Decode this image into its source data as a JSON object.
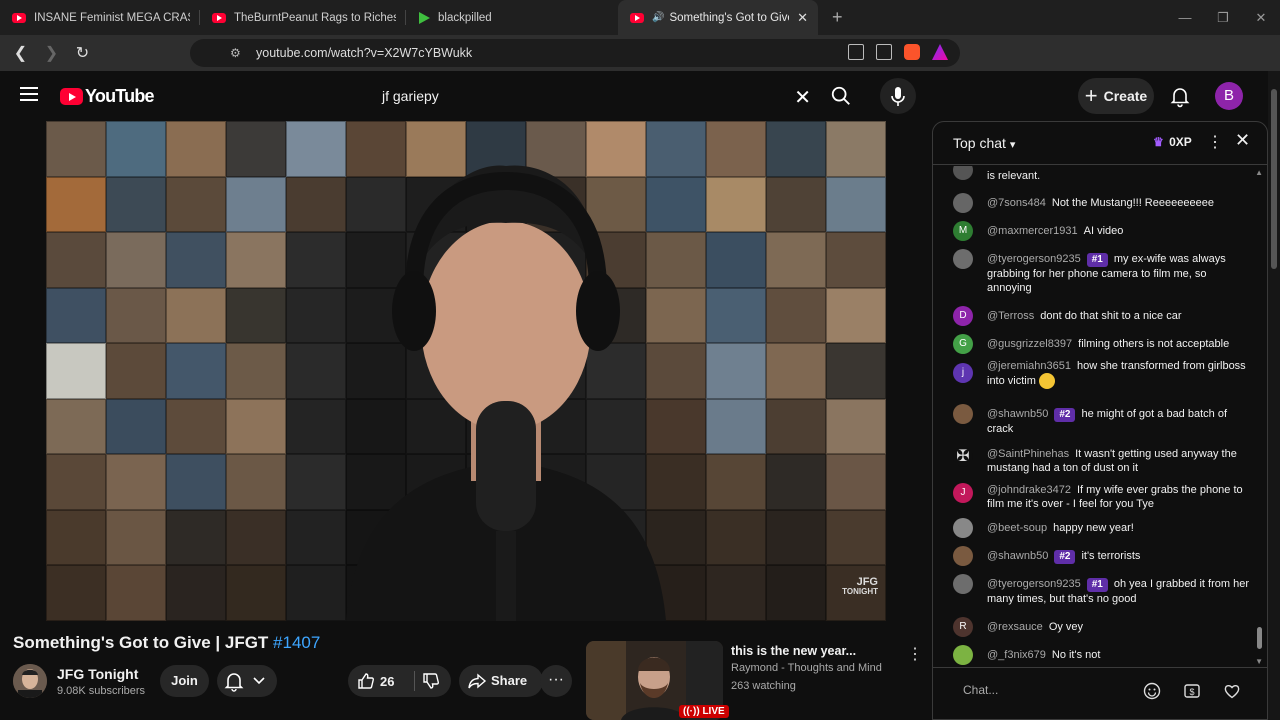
{
  "browser": {
    "tabs": [
      {
        "label": "INSANE Feminist MEGA CRASHOUT",
        "icon": "youtube-icon"
      },
      {
        "label": "TheBurntPeanut Rags to Riches | ARC",
        "icon": "youtube-icon"
      },
      {
        "label": "blackpilled",
        "icon": "play-green-icon"
      },
      {
        "label": "Something's Got to Give | JFGT",
        "icon": "youtube-icon",
        "active": true
      }
    ],
    "url": "youtube.com/watch?v=X2W7cYBWukk"
  },
  "masthead": {
    "logo_text": "YouTube",
    "search_query": "jf gariepy",
    "create_label": "Create",
    "avatar_letter": "B"
  },
  "video": {
    "title_main": "Something's Got to Give | JFGT ",
    "title_hashtag": "#1407",
    "watermark_line1": "JFG",
    "watermark_line2": "TONIGHT",
    "channel": "JFG Tonight",
    "subscribers": "9.08K subscribers",
    "join_label": "Join",
    "likes": "26",
    "share_label": "Share",
    "more_label": "···"
  },
  "suggested": {
    "title": "this is the new year...",
    "channel": "Raymond - Thoughts and Mind",
    "watching": "263 watching",
    "live_label": "LIVE"
  },
  "chat": {
    "header": "Top chat",
    "xp": "0XP",
    "input_placeholder": "Chat...",
    "messages": [
      {
        "author": "",
        "text": "is relevant.",
        "badge": "",
        "avatar": "",
        "color": "#555"
      },
      {
        "author": "@7sons484",
        "text": "Not the Mustang!!! Reeeeeeeeee",
        "badge": "",
        "avatar": "",
        "color": "#666"
      },
      {
        "author": "@maxmercer1931",
        "text": "AI video",
        "badge": "",
        "avatar": "M",
        "color": "#2e7d32"
      },
      {
        "author": "@tyerogerson9235",
        "text": "my ex-wife was always grabbing for her phone camera to film me, so annoying",
        "badge": "#1",
        "avatar": "",
        "color": "#6d6d6d"
      },
      {
        "author": "@Terross",
        "text": "dont do that shit to a nice car",
        "badge": "",
        "avatar": "D",
        "color": "#8e24aa"
      },
      {
        "author": "@gusgrizzel8397",
        "text": "filming others is not acceptable",
        "badge": "",
        "avatar": "G",
        "color": "#43a047"
      },
      {
        "author": "@jeremiahn3651",
        "text": "how she transformed from girlboss into victim",
        "badge": "",
        "avatar": "j",
        "color": "#5e35b1"
      },
      {
        "author": "@shawnb50",
        "text": "he might of got a bad batch of crack",
        "badge": "#2",
        "avatar": "",
        "color": "#7a5a40"
      },
      {
        "author": "@SaintPhinehas",
        "text": "It wasn't getting used anyway the mustang had a ton of dust on it",
        "badge": "",
        "avatar": "✠",
        "color": "#0f0f0f"
      },
      {
        "author": "@johndrake3472",
        "text": "If my wife ever grabs the phone to film me it's over - I feel for you Tye",
        "badge": "",
        "avatar": "J",
        "color": "#c2185b"
      },
      {
        "author": "@beet-soup",
        "text": "happy new year!",
        "badge": "",
        "avatar": "",
        "color": "#888"
      },
      {
        "author": "@shawnb50",
        "text": "it's terrorists",
        "badge": "#2",
        "avatar": "",
        "color": "#7a5a40"
      },
      {
        "author": "@tyerogerson9235",
        "text": "oh yea I grabbed it from her many times, but that's no good",
        "badge": "#1",
        "avatar": "",
        "color": "#6d6d6d"
      },
      {
        "author": "@rexsauce",
        "text": "Oy vey",
        "badge": "",
        "avatar": "R",
        "color": "#4e342e"
      },
      {
        "author": "@_f3nix679",
        "text": "No it's not",
        "badge": "",
        "avatar": "",
        "color": "#7cb342"
      }
    ]
  }
}
